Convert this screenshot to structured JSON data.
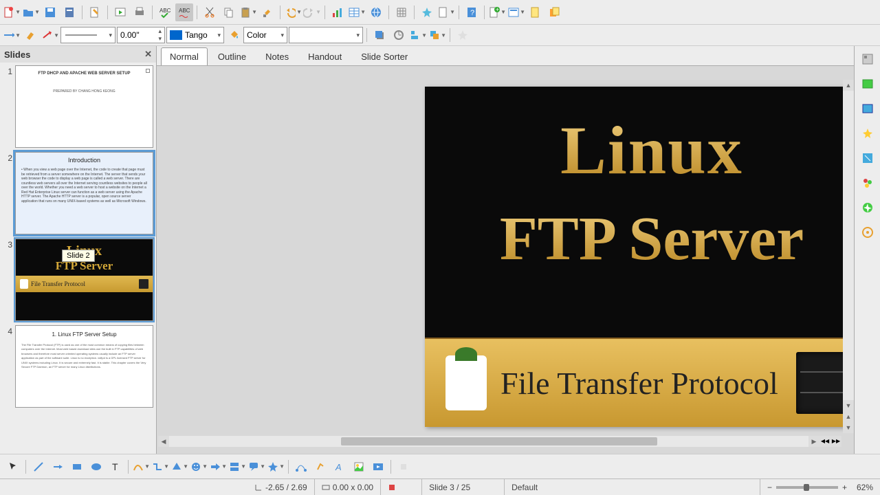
{
  "toolbar1": {
    "icons": [
      "new-doc",
      "open",
      "save",
      "save-as",
      "edit",
      "slideshow",
      "print",
      "spellcheck-abc",
      "spellcheck-abc-toggle",
      "cut",
      "copy",
      "paste",
      "format-paint",
      "undo",
      "redo",
      "insert-chart",
      "insert-table",
      "insert-hyperlink",
      "grid",
      "snap",
      "insert-slide",
      "help",
      "navigator",
      "new-slide-layout",
      "slide-properties",
      "new-blank",
      "cascade"
    ]
  },
  "toolbar2": {
    "line_width": "0.00\"",
    "color_name": "Tango",
    "color_label": "Color"
  },
  "slides_panel": {
    "title": "Slides",
    "tooltip": "Slide 2",
    "items": [
      {
        "num": "1",
        "title": "FTP DHCP AND APACHE WEB SERVER SETUP",
        "sub": "PREPARED BY CHANG HONG KEONG"
      },
      {
        "num": "2",
        "title": "Introduction",
        "body": "• When you view a web page over the Internet, the code to create that page must be retrieved from a server somewhere on the Internet. The server that sends your web browser the code to display a web page is called a web server. There are countless web servers all over the Internet serving countless websites to people all over the world. Whether you need a web server to host a website on the Internet a Red Hat Enterprise Linux server can function as a web server using the Apache HTTP server. The Apache HTTP server is a popular, open source server application that runs on many UNIX-based systems as well as Microsoft Windows."
      },
      {
        "num": "3",
        "linux": "Linux",
        "ftp": "FTP Server",
        "bar": "File Transfer Protocol"
      },
      {
        "num": "4",
        "title": "1. Linux FTP Server Setup",
        "body": "The File Transfer Protocol (FTP) is used as one of the most common means of copying files between computers over the Internet. Most web based download sites use the built in FTP capabilities of web browsers and therefore most server oriented operating systems usually include an FTP server application as part of the software suite. Linux is no exception. vsftpd is a GPL licensed FTP server for UNIX systems including Linux. It is secure and extremely fast. It is stable. This chapter covers the Very Secure FTP Daemon, an FTP server for many Linux distributions."
      }
    ]
  },
  "view_tabs": {
    "items": [
      "Normal",
      "Outline",
      "Notes",
      "Handout",
      "Slide Sorter"
    ],
    "active": "Normal"
  },
  "canvas": {
    "linux": "Linux",
    "ftp": "FTP Server",
    "bar": "File Transfer Protocol"
  },
  "bottom_toolbar": {
    "icons": [
      "select",
      "line",
      "arrow",
      "rect",
      "ellipse",
      "text",
      "curve",
      "connector",
      "basic-shapes",
      "symbol",
      "block-arrow",
      "flowchart",
      "callout",
      "star",
      "points",
      "gluepoints",
      "fontwork",
      "from-file",
      "gallery",
      "rotate"
    ]
  },
  "status": {
    "pos": "-2.65 / 2.69",
    "size": "0.00 x 0.00",
    "slide": "Slide 3 / 25",
    "layout": "Default",
    "zoom": "62%"
  }
}
